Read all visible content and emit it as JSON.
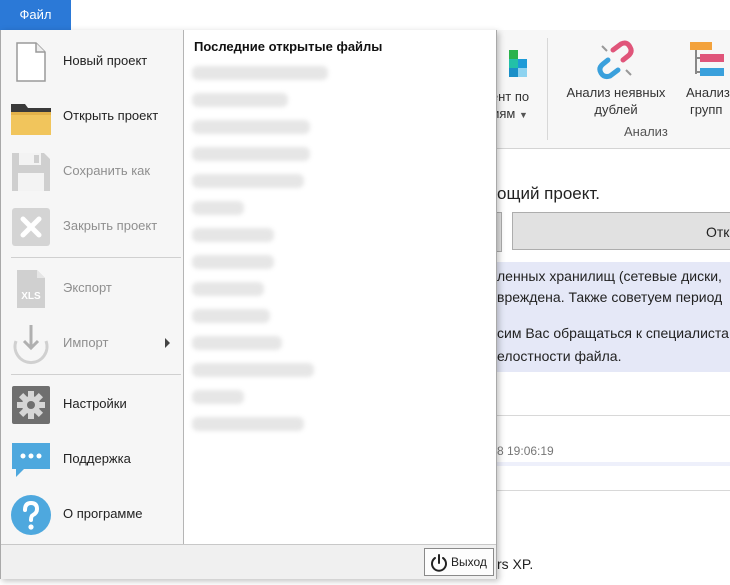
{
  "file_tab": {
    "label": "Файл"
  },
  "menu": {
    "items": [
      {
        "label": "Новый проект",
        "icon": "new-file-icon"
      },
      {
        "label": "Открыть проект",
        "icon": "folder-icon"
      },
      {
        "label": "Сохранить как",
        "icon": "save-icon"
      },
      {
        "label": "Закрыть проект",
        "icon": "close-icon"
      },
      {
        "label": "Экспорт",
        "icon": "xls-file-icon"
      },
      {
        "label": "Импорт",
        "icon": "import-icon"
      },
      {
        "label": "Настройки",
        "icon": "gear-icon"
      },
      {
        "label": "Поддержка",
        "icon": "chat-icon"
      },
      {
        "label": "О программе",
        "icon": "help-icon"
      }
    ],
    "recent": {
      "title": "Последние открытые файлы",
      "item_count_note": ""
    },
    "exit_label": "Выход"
  },
  "background": {
    "ribbon": {
      "btn1_line1": "ент по",
      "btn1_line2": "иям",
      "btn2_line1": "Анализ неявных",
      "btn2_line2": "дублей",
      "btn3_line1": "Анализ",
      "btn3_line2": "групп",
      "group_label": "Анализ"
    },
    "heading": "ощий проект.",
    "open_button": "Отк",
    "notice_lines": [
      "ленных хранилищ (сетевые диски,",
      "вреждена. Также советуем период",
      "сим Вас обращаться к специалиста",
      "елостности файла."
    ],
    "date_text": "8 19:06:19",
    "xp_text": "rs XP."
  },
  "colors": {
    "accent": "#2b79d7",
    "notice_bg": "#e5e8f7",
    "disabled_text": "#8f8f8f"
  }
}
